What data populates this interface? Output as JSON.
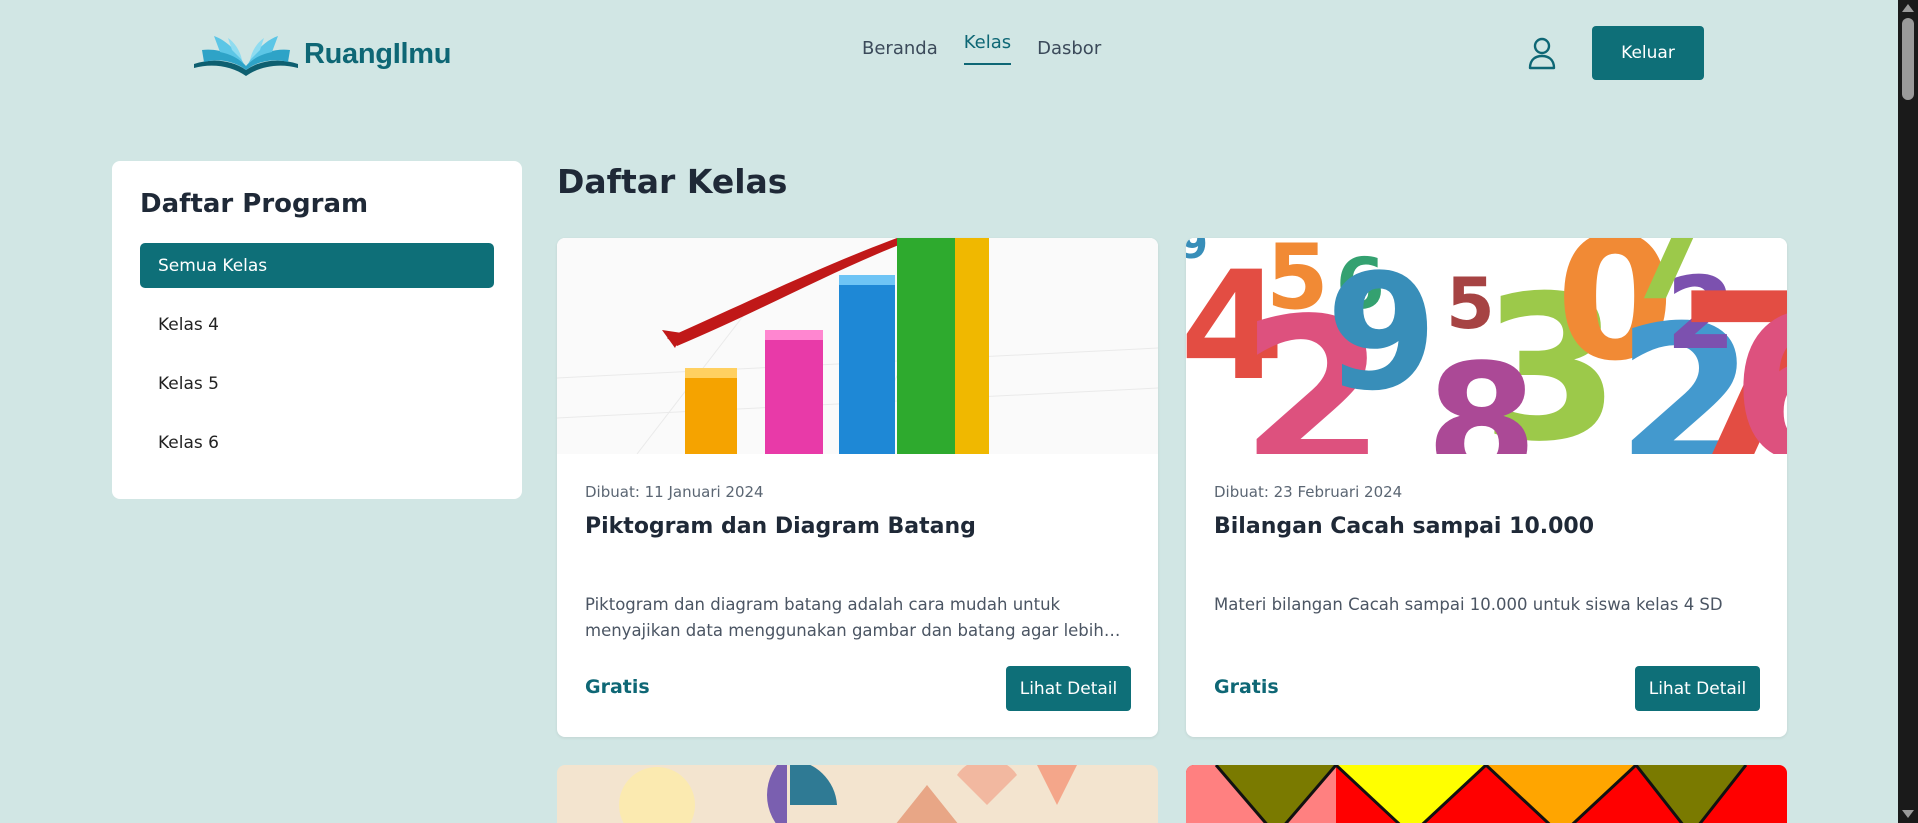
{
  "brand": {
    "name": "RuangIlmu",
    "color": "#0e6775"
  },
  "nav": {
    "items": [
      {
        "label": "Beranda",
        "active": false
      },
      {
        "label": "Kelas",
        "active": true
      },
      {
        "label": "Dasbor",
        "active": false
      }
    ],
    "user_icon": "user-icon",
    "logout_label": "Keluar"
  },
  "sidebar": {
    "title": "Daftar Program",
    "items": [
      {
        "label": "Semua Kelas",
        "active": true
      },
      {
        "label": "Kelas 4",
        "active": false
      },
      {
        "label": "Kelas 5",
        "active": false
      },
      {
        "label": "Kelas 6",
        "active": false
      }
    ]
  },
  "main": {
    "title": "Daftar Kelas",
    "cards": [
      {
        "date": "Dibuat: 11 Januari 2024",
        "title": "Piktogram dan Diagram Batang",
        "description": "Piktogram dan diagram batang adalah cara mudah untuk menyajikan data menggunakan gambar dan batang agar lebih cepat dipahami.",
        "price": "Gratis",
        "button": "Lihat Detail",
        "image": "bar-chart-illustration"
      },
      {
        "date": "Dibuat: 23 Februari 2024",
        "title": "Bilangan Cacah sampai 10.000",
        "description": "Materi bilangan Cacah sampai 10.000 untuk siswa kelas 4 SD",
        "price": "Gratis",
        "button": "Lihat Detail",
        "image": "colorful-numbers-illustration"
      }
    ]
  },
  "colors": {
    "accent": "#0e6f78",
    "background": "#d1e6e4"
  }
}
